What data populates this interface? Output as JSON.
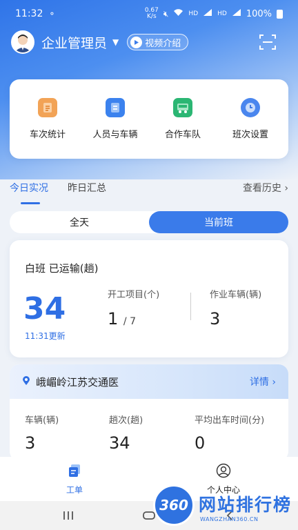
{
  "status_bar": {
    "time": "11:32",
    "net_speed_top": "0.67",
    "net_speed_unit": "K/s",
    "signal_hd": "HD",
    "signal_4g": "4G",
    "battery": "100%"
  },
  "header": {
    "role": "企业管理员",
    "video_label": "视频介绍"
  },
  "quick_menu": [
    {
      "label": "车次统计",
      "icon": "stats-doc-icon",
      "color": "#f2a356"
    },
    {
      "label": "人员与车辆",
      "icon": "personnel-vehicle-icon",
      "color": "#3b82ee"
    },
    {
      "label": "合作车队",
      "icon": "truck-icon",
      "color": "#2bb673"
    },
    {
      "label": "班次设置",
      "icon": "clock-icon",
      "color": "#4a86ee"
    }
  ],
  "tabs": {
    "today": "今日实况",
    "yesterday": "昨日汇总",
    "history": "查看历史 ›"
  },
  "segment": {
    "all_day": "全天",
    "current_shift": "当前班"
  },
  "shift_card": {
    "title": "白班  已运输(趟)",
    "trips": "34",
    "updated": "11:31更新",
    "projects_label": "开工项目(个)",
    "projects_value": "1",
    "projects_total": "/ 7",
    "vehicles_label": "作业车辆(辆)",
    "vehicles_value": "3"
  },
  "site_card": {
    "name": "峨嵋岭江苏交通医",
    "detail": "详情 ›",
    "vehicles_label": "车辆(辆)",
    "vehicles_value": "3",
    "trips_label": "趟次(趟)",
    "trips_value": "34",
    "avg_label": "平均出车时间(分)",
    "avg_value": "0"
  },
  "bottom_nav": {
    "work": "工单",
    "profile": "个人中心"
  },
  "watermark": {
    "badge": "360",
    "text": "网站排行榜",
    "url": "WANGZHAN360.CN"
  },
  "colors": {
    "accent": "#2f6fe4",
    "segment_on": "#3a7bea"
  }
}
